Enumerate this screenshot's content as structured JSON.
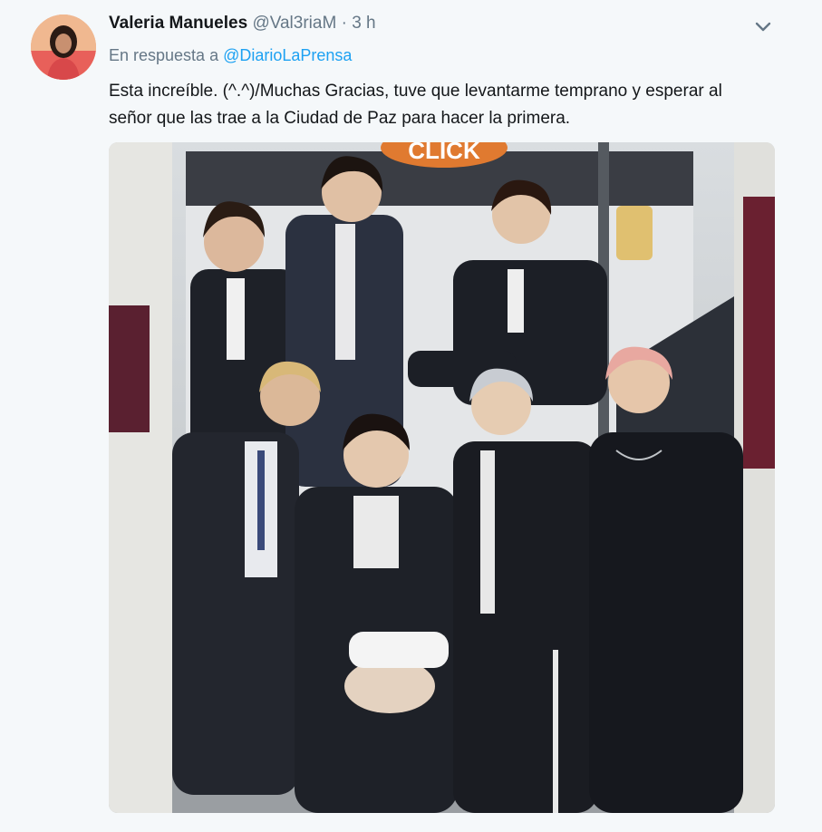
{
  "tweet": {
    "author_name": "Valeria Manueles",
    "author_handle": "@Val3riaM",
    "separator": "·",
    "time": "3 h",
    "reply_prefix": "En respuesta a",
    "reply_mention": "@DiarioLaPrensa",
    "text_line1": "Esta increíble. (^.^)/Muchas Gracias, tuve que levantarme temprano y esperar al",
    "text_line2": "señor que las trae a la Ciudad de Paz para hacer la primera.",
    "media_sign_text": "CLICK"
  },
  "icons": {
    "menu": "chevron-down-icon"
  },
  "colors": {
    "name": "#14171a",
    "secondary": "#657786",
    "link": "#1da1f2",
    "background": "#f5f8fa"
  }
}
